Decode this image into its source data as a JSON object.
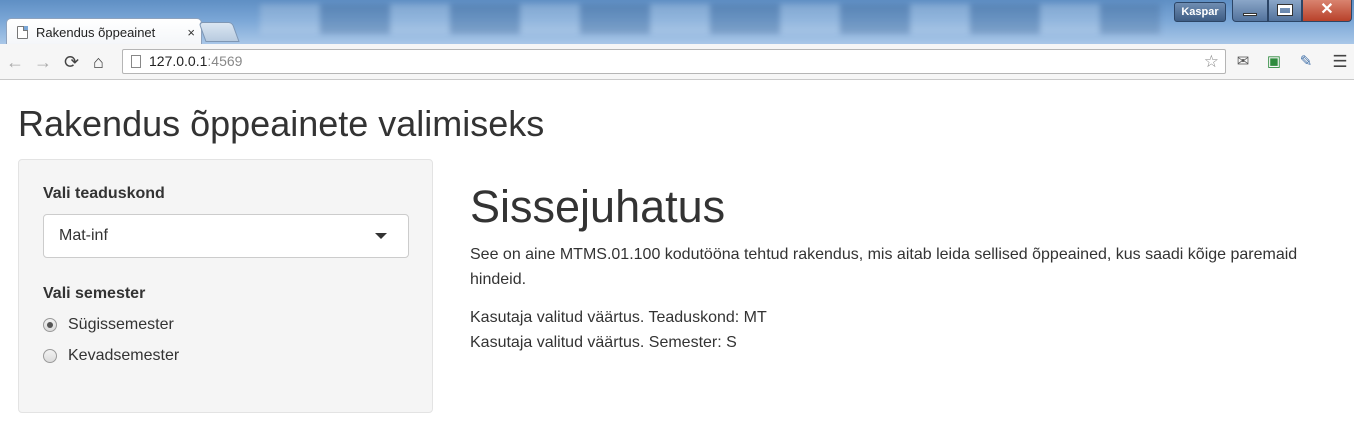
{
  "browser": {
    "tab_title": "Rakendus õppeainet",
    "tab_close": "×",
    "user_name": "Kaspar",
    "url_host": "127.0.0.1",
    "url_port": ":4569",
    "icons": {
      "back": "←",
      "forward": "→",
      "reload": "⟳",
      "home": "⌂",
      "star": "☆",
      "mail": "✉",
      "extension": "▣",
      "tool": "✎",
      "menu": "☰",
      "close": "✕"
    }
  },
  "page": {
    "title": "Rakendus õppeainete valimiseks"
  },
  "sidebar": {
    "faculty_label": "Vali teaduskond",
    "faculty_selected": "Mat-inf",
    "semester_label": "Vali semester",
    "semester_options": [
      {
        "label": "Sügissemester",
        "checked": true
      },
      {
        "label": "Kevadsemester",
        "checked": false
      }
    ]
  },
  "main": {
    "heading": "Sissejuhatus",
    "intro": "See on aine MTMS.01.100 kodutööna tehtud rakendus, mis aitab leida sellised õppeained, kus saadi kõige paremaid hindeid.",
    "faculty_line": "Kasutaja valitud väärtus. Teaduskond: MT",
    "semester_line": "Kasutaja valitud väärtus. Semester: S"
  }
}
